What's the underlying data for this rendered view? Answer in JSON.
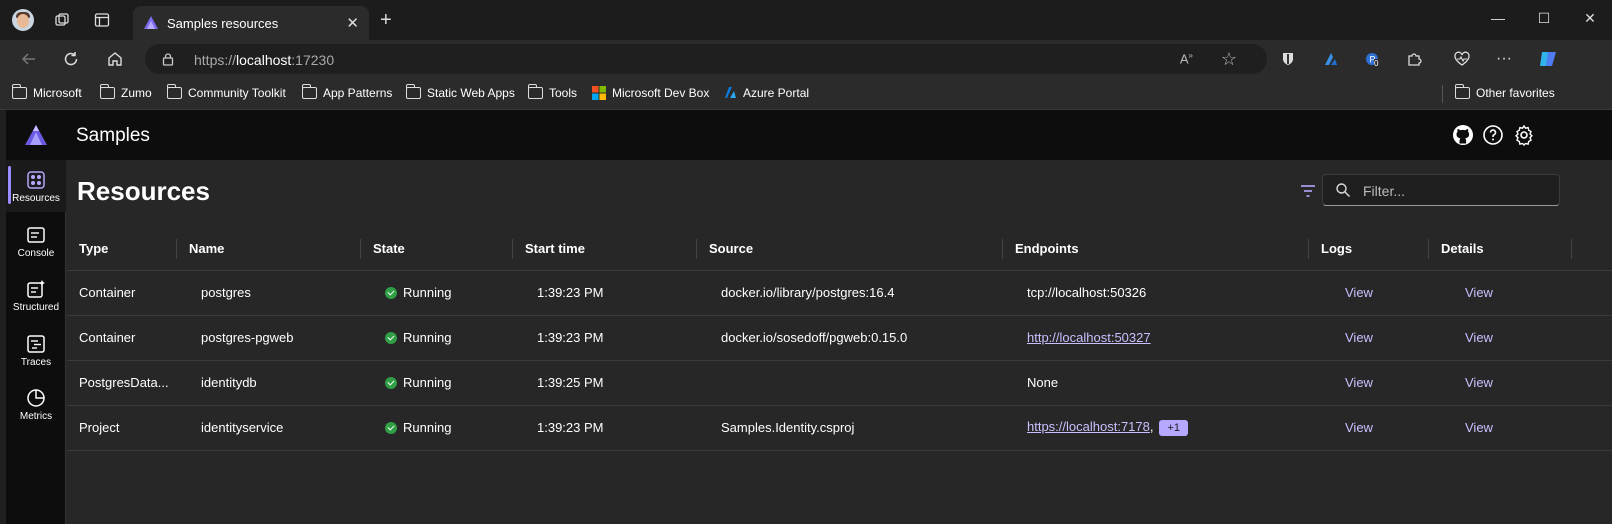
{
  "browser": {
    "tab_title": "Samples resources",
    "tab_close": "✕",
    "new_tab": "+",
    "url_scheme": "https://",
    "url_host": "localhost",
    "url_port": ":17230",
    "window_controls": [
      "—",
      "☐",
      "✕"
    ],
    "favorites": [
      {
        "label": "Microsoft",
        "icon": "folder-icon"
      },
      {
        "label": "Zumo",
        "icon": "folder-icon"
      },
      {
        "label": "Community Toolkit",
        "icon": "folder-icon"
      },
      {
        "label": "App Patterns",
        "icon": "folder-icon"
      },
      {
        "label": "Static Web Apps",
        "icon": "folder-icon"
      },
      {
        "label": "Tools",
        "icon": "folder-icon"
      },
      {
        "label": "Microsoft Dev Box",
        "icon": "microsoft-logo-icon"
      },
      {
        "label": "Azure Portal",
        "icon": "azure-logo-icon"
      }
    ],
    "other_favorites": "Other favorites",
    "extension_badge": "0"
  },
  "app": {
    "title": "Samples",
    "nav": [
      {
        "label": "Resources",
        "icon": "resources-icon",
        "active": true
      },
      {
        "label": "Console",
        "icon": "console-icon",
        "active": false
      },
      {
        "label": "Structured",
        "icon": "structured-icon",
        "active": false
      },
      {
        "label": "Traces",
        "icon": "traces-icon",
        "active": false
      },
      {
        "label": "Metrics",
        "icon": "metrics-icon",
        "active": false
      }
    ],
    "accent": "#9b8cff"
  },
  "page": {
    "title": "Resources",
    "filter_placeholder": "Filter..."
  },
  "table": {
    "columns": [
      "Type",
      "Name",
      "State",
      "Start time",
      "Source",
      "Endpoints",
      "Logs",
      "Details"
    ],
    "rows": [
      {
        "type": "Container",
        "name": "postgres",
        "state": "Running",
        "start": "1:39:23 PM",
        "source": "docker.io/library/postgres:16.4",
        "endpoint": "tcp://localhost:50326",
        "endpoint_link": false,
        "extra": "",
        "logs": "View",
        "details": "View"
      },
      {
        "type": "Container",
        "name": "postgres-pgweb",
        "state": "Running",
        "start": "1:39:23 PM",
        "source": "docker.io/sosedoff/pgweb:0.15.0",
        "endpoint": "http://localhost:50327",
        "endpoint_link": true,
        "extra": "",
        "logs": "View",
        "details": "View"
      },
      {
        "type": "PostgresData...",
        "name": "identitydb",
        "state": "Running",
        "start": "1:39:25 PM",
        "source": "",
        "endpoint": "None",
        "endpoint_link": false,
        "extra": "",
        "logs": "View",
        "details": "View"
      },
      {
        "type": "Project",
        "name": "identityservice",
        "state": "Running",
        "start": "1:39:23 PM",
        "source": "Samples.Identity.csproj",
        "endpoint": "https://localhost:7178",
        "endpoint_link": true,
        "extra": "+1",
        "logs": "View",
        "details": "View"
      }
    ]
  }
}
